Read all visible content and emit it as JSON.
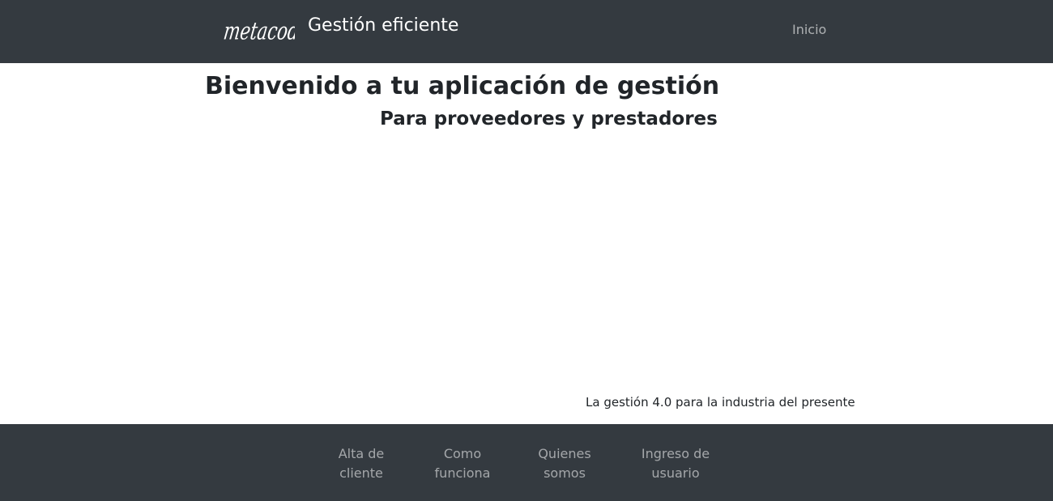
{
  "navbar": {
    "logo_text": "metacodo",
    "brand_title": "Gestión eficiente",
    "links": [
      "Inicio"
    ]
  },
  "main": {
    "title": "Bienvenido a tu aplicación de gestión",
    "subtitle": "Para proveedores y prestadores",
    "tagline": "La gestión 4.0 para la industria del presente"
  },
  "footer": {
    "links": [
      {
        "line1": "Alta de",
        "line2": "cliente"
      },
      {
        "line1": "Como",
        "line2": "funciona"
      },
      {
        "line1": "Quienes",
        "line2": "somos"
      },
      {
        "line1": "Ingreso de",
        "line2": "usuario"
      }
    ]
  },
  "colors": {
    "bar_background": "#343a40",
    "text_dark": "#212529",
    "nav_link": "#9a9da0"
  }
}
